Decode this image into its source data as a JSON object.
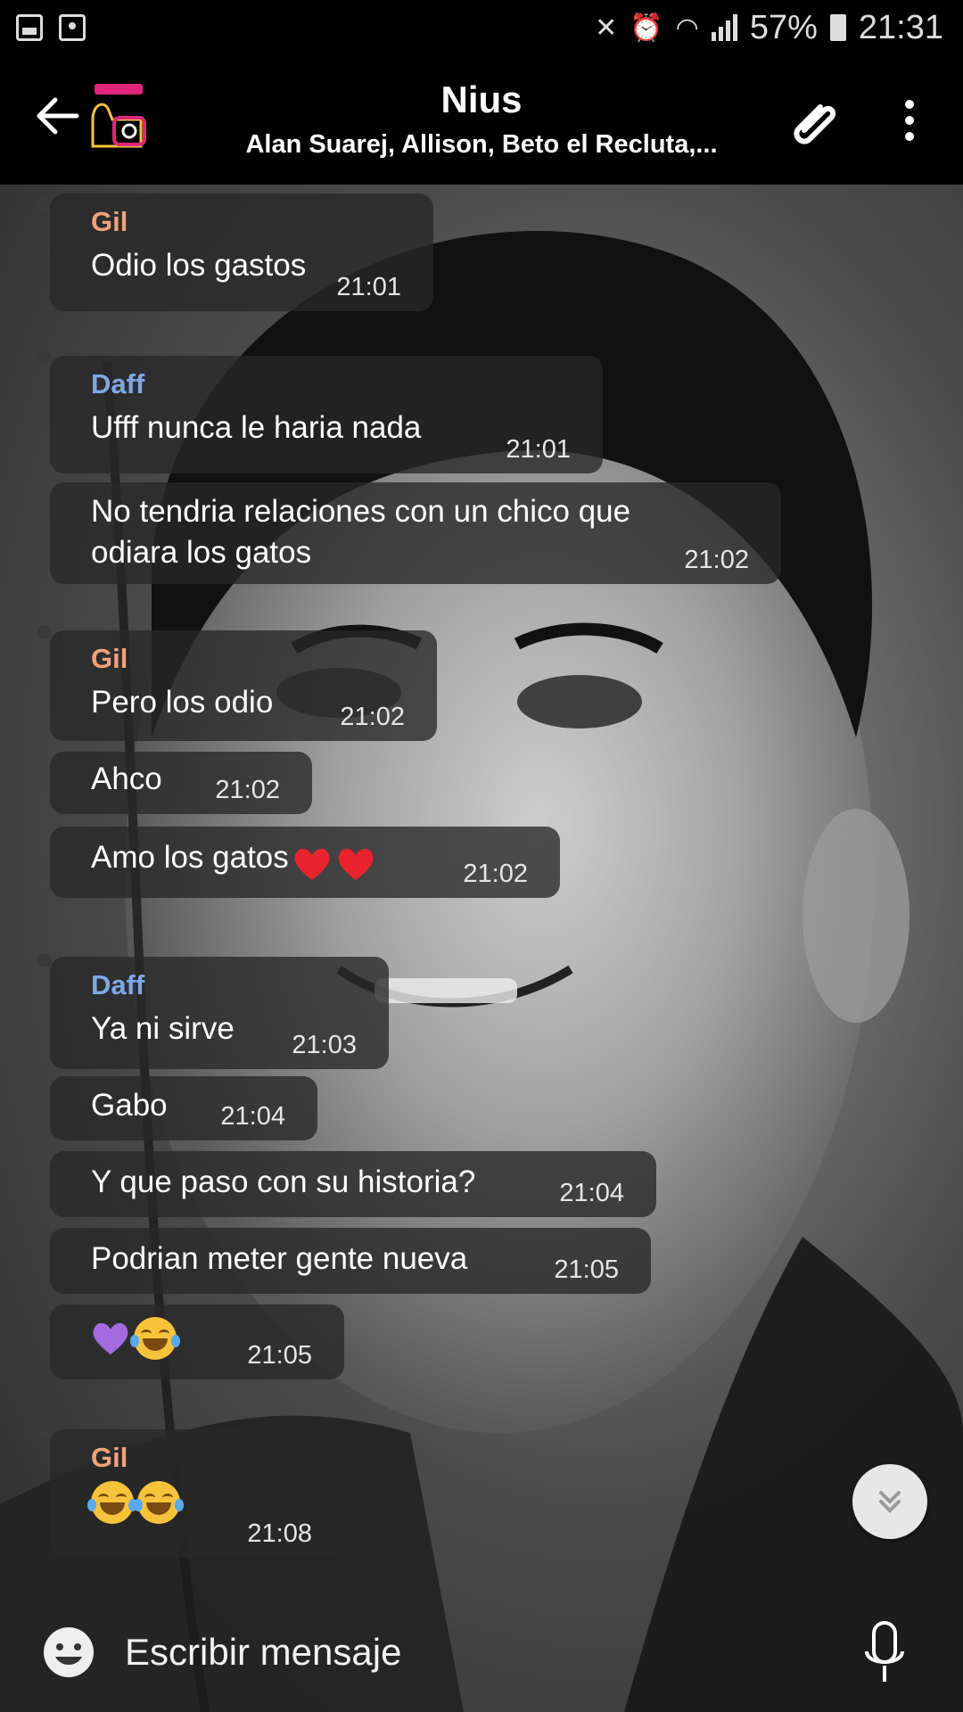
{
  "status_bar": {
    "battery": "57%",
    "time": "21:31"
  },
  "header": {
    "title": "Nius",
    "members": "Alan Suarej, Allison, Beto el Recluta,..."
  },
  "messages": [
    {
      "sender": "Gil",
      "text": "Odio los gastos",
      "time": "21:01"
    },
    {
      "sender": "Daff",
      "text": "Ufff nunca le haria nada",
      "time": "21:01"
    },
    {
      "text_line1": "No tendria relaciones con un chico que",
      "text_line2": "odiara los gatos",
      "time": "21:02"
    },
    {
      "sender": "Gil",
      "text": "Pero los odio",
      "time": "21:02"
    },
    {
      "text": "Ahco",
      "time": "21:02"
    },
    {
      "text": "Amo los gatos",
      "time": "21:02",
      "emojis": [
        "red-heart",
        "red-heart"
      ]
    },
    {
      "sender": "Daff",
      "text": "Ya ni sirve",
      "time": "21:03"
    },
    {
      "text": "Gabo",
      "time": "21:04"
    },
    {
      "text": "Y que paso con su historia?",
      "time": "21:04"
    },
    {
      "text": "Podrian meter gente nueva",
      "time": "21:05"
    },
    {
      "time": "21:05",
      "emojis": [
        "purple-heart",
        "tears-of-joy"
      ]
    },
    {
      "sender": "Gil",
      "time": "21:08",
      "emojis": [
        "tears-of-joy",
        "tears-of-joy"
      ]
    }
  ],
  "composer": {
    "placeholder": "Escribir mensaje"
  },
  "colors": {
    "gil": "#f0a27a",
    "daff": "#7fa7e6",
    "bubble": "rgba(40,40,40,0.78)"
  }
}
